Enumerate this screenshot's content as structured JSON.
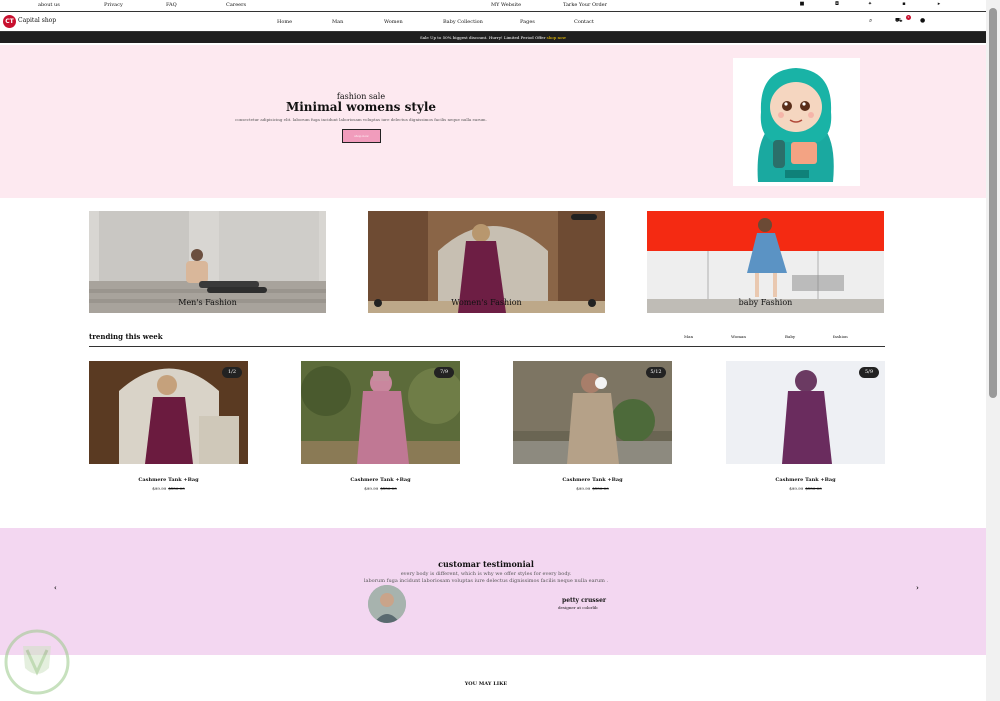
{
  "topbar": {
    "links": [
      "about us",
      "Privacy",
      "FAQ",
      "Careers",
      "MY Website",
      "Tarke Your Order"
    ],
    "social_icons": [
      "facebook-icon",
      "instagram-icon",
      "twitter-icon",
      "linkedin-icon",
      "youtube-icon"
    ]
  },
  "navbar": {
    "brand": "Capital shop",
    "logo_text": "CT",
    "menu": [
      "Home",
      "Man",
      "Women",
      "Baby Collection",
      "Pages",
      "Contact"
    ],
    "cart_count": "2"
  },
  "promo": {
    "text": "Sale Up to 50% biggest discount. Hurry! Limited Period Offer",
    "link": "shop now"
  },
  "hero": {
    "subtitle": "fashion sale",
    "title": "Minimal womens style",
    "description": "consectetur adipisicing elit. laborum fuga incidunt laboriosam voluptas iure delectus dignissimos facilis neque nulla earum.",
    "button": "shop now"
  },
  "categories": [
    {
      "label": "Men's Fashion"
    },
    {
      "label": "Women's Fashion"
    },
    {
      "label": "baby Fashion"
    }
  ],
  "trending": {
    "title": "trending this week",
    "tabs": [
      "Man",
      "Woman",
      "Baby",
      "fashion"
    ],
    "products": [
      {
        "name": "Cashmere Tank +Bag",
        "price": "$99.99",
        "old_price": "$150.00",
        "counter": "1/2"
      },
      {
        "name": "Cashmere Tank +Bag",
        "price": "$99.99",
        "old_price": "$150.00",
        "counter": "7/9"
      },
      {
        "name": "Cashmere Tank +Bag",
        "price": "$99.99",
        "old_price": "$150.00",
        "counter": "5/12"
      },
      {
        "name": "Cashmere Tank +Bag",
        "price": "$99.99",
        "old_price": "$150.00",
        "counter": "5/9"
      }
    ]
  },
  "testimonial": {
    "title": "customar testimonial",
    "line1": "every body is different, which is why we offer styles for every body.",
    "line2": "laborum fuga incidunt laboriosam voluptas iure delectus dignissimos facilis neque nulla earum .",
    "name": "petty crusser",
    "role": "designer at colorlib",
    "prev": "‹",
    "next": "›"
  },
  "you_may_like": "YOU MAY LIKE",
  "colors": {
    "hero_bg": "#fde9f0",
    "testimonial_bg": "#f3d7f1",
    "accent_pink": "#f19cbc",
    "promo_bg": "#1f1f1f",
    "logo_red": "#c8102e"
  }
}
